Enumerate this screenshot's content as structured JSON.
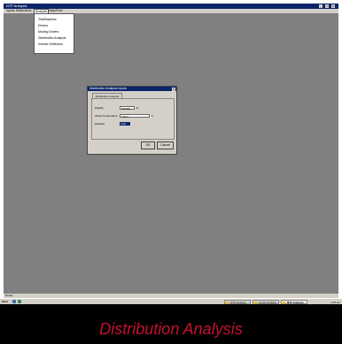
{
  "window": {
    "title": "NTF Analysis",
    "controls": [
      "_",
      "□",
      "✕"
    ]
  },
  "menubar": {
    "items": [
      {
        "label": "Inputs"
      },
      {
        "label": "Deflections"
      },
      {
        "label": "Analysis",
        "active": true
      },
      {
        "label": "Help/Print"
      }
    ]
  },
  "analysis_menu": {
    "items": [
      "Test/Baseline",
      "Drivers",
      "Moving Drivers",
      "Distribution Analysis",
      "Inverse Deflection"
    ]
  },
  "dialog": {
    "title": "Distribution Analysis Inputs",
    "close": "✕",
    "tab": "Distribution Analysis",
    "fields": [
      {
        "label": "Rigidity",
        "value": "200000",
        "unit": "lb"
      },
      {
        "label": "Shear Temperature",
        "value": "Y42.2",
        "unit": "F"
      },
      {
        "label": "Defaults",
        "value": "4.20"
      }
    ],
    "ok_label": "OK",
    "cancel_label": "Cancel"
  },
  "statusbar": {
    "text": "Ready"
  },
  "taskbar": {
    "start_label": "Start",
    "tasks": [
      {
        "label": "NTF Analysis",
        "active": false
      },
      {
        "label": "Curve Analysis",
        "active": false
      },
      {
        "label": "NTF Analysis",
        "active": true
      }
    ],
    "tray_time": "1:35 pm"
  },
  "caption": "Distribution Analysis"
}
